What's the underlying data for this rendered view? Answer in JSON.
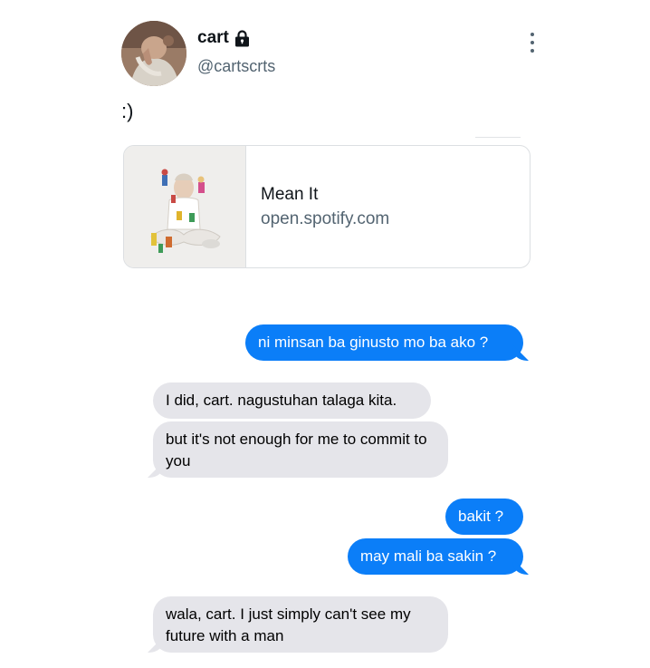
{
  "tweet": {
    "display_name": "cart",
    "handle": "@cartscrts",
    "text": ":)",
    "verified_icon": "lock-icon",
    "menu_icon": "more-vertical-icon",
    "card": {
      "title": "Mean It",
      "domain": "open.spotify.com",
      "thumbnail": "album-art-image"
    }
  },
  "messages": [
    {
      "side": "sent",
      "text": "ni minsan ba ginusto mo ba ako ?"
    },
    {
      "side": "received",
      "text": "I did, cart. nagustuhan talaga kita."
    },
    {
      "side": "received",
      "text": "but it's not enough for me to commit to you"
    },
    {
      "side": "sent",
      "text": "bakit ?"
    },
    {
      "side": "sent",
      "text": "may mali ba sakin ?"
    },
    {
      "side": "received",
      "text": "wala, cart. I just simply can't see my future with a man"
    }
  ],
  "colors": {
    "sent_bubble": "#0b7ef8",
    "received_bubble": "#e5e5ea",
    "secondary_text": "#536471"
  }
}
